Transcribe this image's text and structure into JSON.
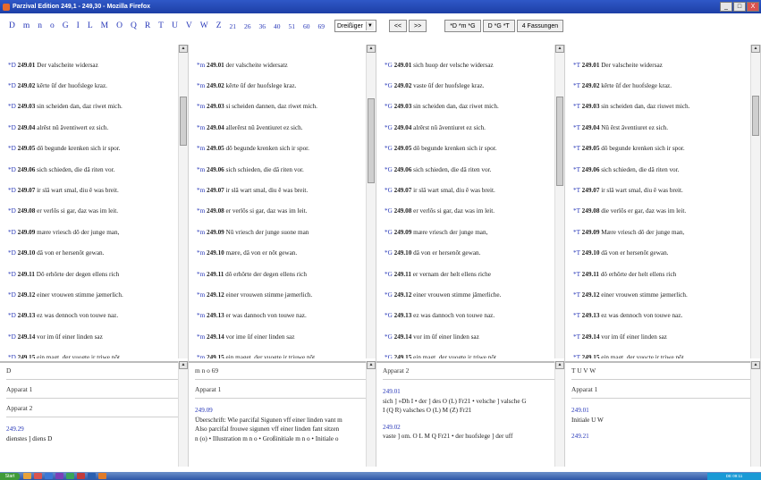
{
  "window": {
    "title": "Parzival Edition 249,1 - 249,30 - Mozilla Firefox",
    "buttons": [
      "_",
      "□",
      "X"
    ]
  },
  "nav": {
    "links": [
      "D",
      "m",
      "n",
      "o",
      "G",
      "I",
      "L",
      "M",
      "O",
      "Q",
      "R",
      "T",
      "U",
      "V",
      "W",
      "Z"
    ],
    "numbers": [
      "21",
      "26",
      "36",
      "40",
      "51",
      "60",
      "69"
    ],
    "select_value": "Dreißiger",
    "prev": "<<",
    "next": ">>",
    "btn1": "*D *m *G",
    "btn2": "D *G *T",
    "btn3": "4 Fassungen"
  },
  "panels": [
    {
      "verses": [
        {
          "sig": "*D",
          "ref": "249.01",
          "text": " Der valscheite widersaz"
        },
        {
          "sig": "*D",
          "ref": "249.02",
          "text": " kêrte ûf der huofslege kraz."
        },
        {
          "sig": "*D",
          "ref": "249.03",
          "text": " sin scheiden dan, daz riwet mich."
        },
        {
          "sig": "*D",
          "ref": "249.04",
          "text": " alrêst nû âventiwert ez sich."
        },
        {
          "sig": "*D",
          "ref": "249.05",
          "text": " dô begunde krenken sich ir spor."
        },
        {
          "sig": "*D",
          "ref": "249.06",
          "text": " sich schieden, die dâ riten vor."
        },
        {
          "sig": "*D",
          "ref": "249.07",
          "text": " ir slâ wart smal, diu ê was breit."
        },
        {
          "sig": "*D",
          "ref": "249.08",
          "text": " er verlôs si gar, daz was im leit."
        },
        {
          "sig": "*D",
          "ref": "249.09",
          "text": " mære vriesch dô der junge man,"
        },
        {
          "sig": "*D",
          "ref": "249.10",
          "text": " dâ von er hersenôt gewan."
        },
        {
          "sig": "*D",
          "ref": "249.11",
          "text": " Dô erhôrte der degen ellens rich"
        },
        {
          "sig": "*D",
          "ref": "249.12",
          "text": " einer vrouwen stimme jæmerlich."
        },
        {
          "sig": "*D",
          "ref": "249.13",
          "text": " ez was dennoch von touwe naz."
        },
        {
          "sig": "*D",
          "ref": "249.14",
          "text": " vor im ûf einer linden saz"
        },
        {
          "sig": "*D",
          "ref": "249.15",
          "text": " ein magt, der vuogte ir triwe nôt."
        }
      ],
      "bottom": {
        "header": "D",
        "app1": "Apparat 1",
        "app2": "Apparat 2",
        "lines": [
          "249.29",
          "dienstes ] diens D"
        ]
      }
    },
    {
      "verses": [
        {
          "sig": "*m",
          "ref": "249.01",
          "text": " der valscheite widersatz"
        },
        {
          "sig": "*m",
          "ref": "249.02",
          "text": " kêrte ûf der huofslege kraz."
        },
        {
          "sig": "*m",
          "ref": "249.03",
          "text": " si scheiden dannen, daz riwet mich."
        },
        {
          "sig": "*m",
          "ref": "249.04",
          "text": " allerêrst nû âventiuret ez sich."
        },
        {
          "sig": "*m",
          "ref": "249.05",
          "text": " dô begunde krenken sich ir spor."
        },
        {
          "sig": "*m",
          "ref": "249.06",
          "text": " sich schieden, die dâ riten vor."
        },
        {
          "sig": "*m",
          "ref": "249.07",
          "text": " ir slâ wart smal, diu ê was breit."
        },
        {
          "sig": "*m",
          "ref": "249.08",
          "text": " er verlôs si gar, daz was im leit."
        },
        {
          "sig": "*m",
          "ref": "249.09",
          "text": " Nû vriesch der junge suone man"
        },
        {
          "sig": "*m",
          "ref": "249.10",
          "text": " mære, dâ von er nôt gewan."
        },
        {
          "sig": "*m",
          "ref": "249.11",
          "text": " dô erhôrte der degen ellens rich"
        },
        {
          "sig": "*m",
          "ref": "249.12",
          "text": " einer vrouwen stimme jæmerlich."
        },
        {
          "sig": "*m",
          "ref": "249.13",
          "text": " er was dannoch von touwe naz."
        },
        {
          "sig": "*m",
          "ref": "249.14",
          "text": " vor ime ûf einer linden saz"
        },
        {
          "sig": "*m",
          "ref": "249.15",
          "text": " ein maget, der vuogte ir triuwe nôt."
        }
      ],
      "bottom": {
        "header": "m n o 69",
        "app1": "Apparat 1",
        "lines": [
          "249.09",
          "Überschrift: Wie parcifal Sigunen vff einer linden vant m",
          "Also parcifal frouwe sigunen vff einer linden fant sitzen",
          "n (o) • Illustration m n o • Großinitiale m n o • Initiale o"
        ]
      }
    },
    {
      "verses": [
        {
          "sig": "*G",
          "ref": "249.01",
          "text": " sich huop der velsche widersaz"
        },
        {
          "sig": "*G",
          "ref": "249.02",
          "text": " vaste ûf der huofslege kraz."
        },
        {
          "sig": "*G",
          "ref": "249.03",
          "text": " sin scheiden dan, daz riwet mich."
        },
        {
          "sig": "*G",
          "ref": "249.04",
          "text": " alrêrst nû âventiuret ez sich."
        },
        {
          "sig": "*G",
          "ref": "249.05",
          "text": " dô begunde krenken sich ir spor."
        },
        {
          "sig": "*G",
          "ref": "249.06",
          "text": " sich schieden, die dâ riten vor."
        },
        {
          "sig": "*G",
          "ref": "249.07",
          "text": " ir slâ wart smal, diu ê was breit."
        },
        {
          "sig": "*G",
          "ref": "249.08",
          "text": " er verlôs si gar, daz was im leit."
        },
        {
          "sig": "*G",
          "ref": "249.09",
          "text": " mære vriesch der junge man,"
        },
        {
          "sig": "*G",
          "ref": "249.10",
          "text": " dâ von er hersenôt gewan."
        },
        {
          "sig": "*G",
          "ref": "249.11",
          "text": " er vernam der helt ellens riche"
        },
        {
          "sig": "*G",
          "ref": "249.12",
          "text": " einer vrouwen stimme jâmerliche."
        },
        {
          "sig": "*G",
          "ref": "249.13",
          "text": " ez was dannoch von touwe naz."
        },
        {
          "sig": "*G",
          "ref": "249.14",
          "text": " vor im ûf einer linden saz"
        },
        {
          "sig": "*G",
          "ref": "249.15",
          "text": " ein magt, der vuogte ir triwe nôt."
        }
      ],
      "bottom": {
        "header": "Apparat 2",
        "lines": [
          "249.01",
          "sich ] »Dh I • der ] des O (L) Fr21 • velsche ] valsche G",
          "I (Q R) valsches O (L) M (Z) Fr21",
          "249.02",
          "vaste ] om. O L M Q Fr21 • der huofslege ] der uff"
        ]
      }
    },
    {
      "verses": [
        {
          "sig": "*T",
          "ref": "249.01",
          "text": " Der valscheite widersaz"
        },
        {
          "sig": "*T",
          "ref": "249.02",
          "text": " kêrte ûf der huofslege kraz."
        },
        {
          "sig": "*T",
          "ref": "249.03",
          "text": " sin scheiden dan, daz riuwet mich."
        },
        {
          "sig": "*T",
          "ref": "249.04",
          "text": " Nû êrst âventiuret ez sich."
        },
        {
          "sig": "*T",
          "ref": "249.05",
          "text": " dô begunde krenken sich ir spor."
        },
        {
          "sig": "*T",
          "ref": "249.06",
          "text": " sich schieden, die dâ riten vor."
        },
        {
          "sig": "*T",
          "ref": "249.07",
          "text": " ir slâ wart smal, diu ê was breit."
        },
        {
          "sig": "*T",
          "ref": "249.08",
          "text": " die verlôs er gar, daz was im leit."
        },
        {
          "sig": "*T",
          "ref": "249.09",
          "text": " Mære vriesch dô der junge man,"
        },
        {
          "sig": "*T",
          "ref": "249.10",
          "text": " dâ von er hersenôt gewan."
        },
        {
          "sig": "*T",
          "ref": "249.11",
          "text": " dô erhôrte der helt ellens rich"
        },
        {
          "sig": "*T",
          "ref": "249.12",
          "text": " einer vrouwen stimme jæmerlich."
        },
        {
          "sig": "*T",
          "ref": "249.13",
          "text": " ez was dennoch von touwe naz."
        },
        {
          "sig": "*T",
          "ref": "249.14",
          "text": " vor im ûf einer linden saz"
        },
        {
          "sig": "*T",
          "ref": "249.15",
          "text": " ein magt, der vuocte ir triwe nôt."
        }
      ],
      "bottom": {
        "header": "T U V W",
        "app1": "Apparat 1",
        "lines": [
          "249.01",
          "Initiale U W",
          "249.21"
        ]
      }
    }
  ],
  "taskbar": {
    "start": "Start",
    "tray": "DE 09:11"
  },
  "colors": {
    "link": "#2737b8",
    "red_initial": "#d01818"
  }
}
